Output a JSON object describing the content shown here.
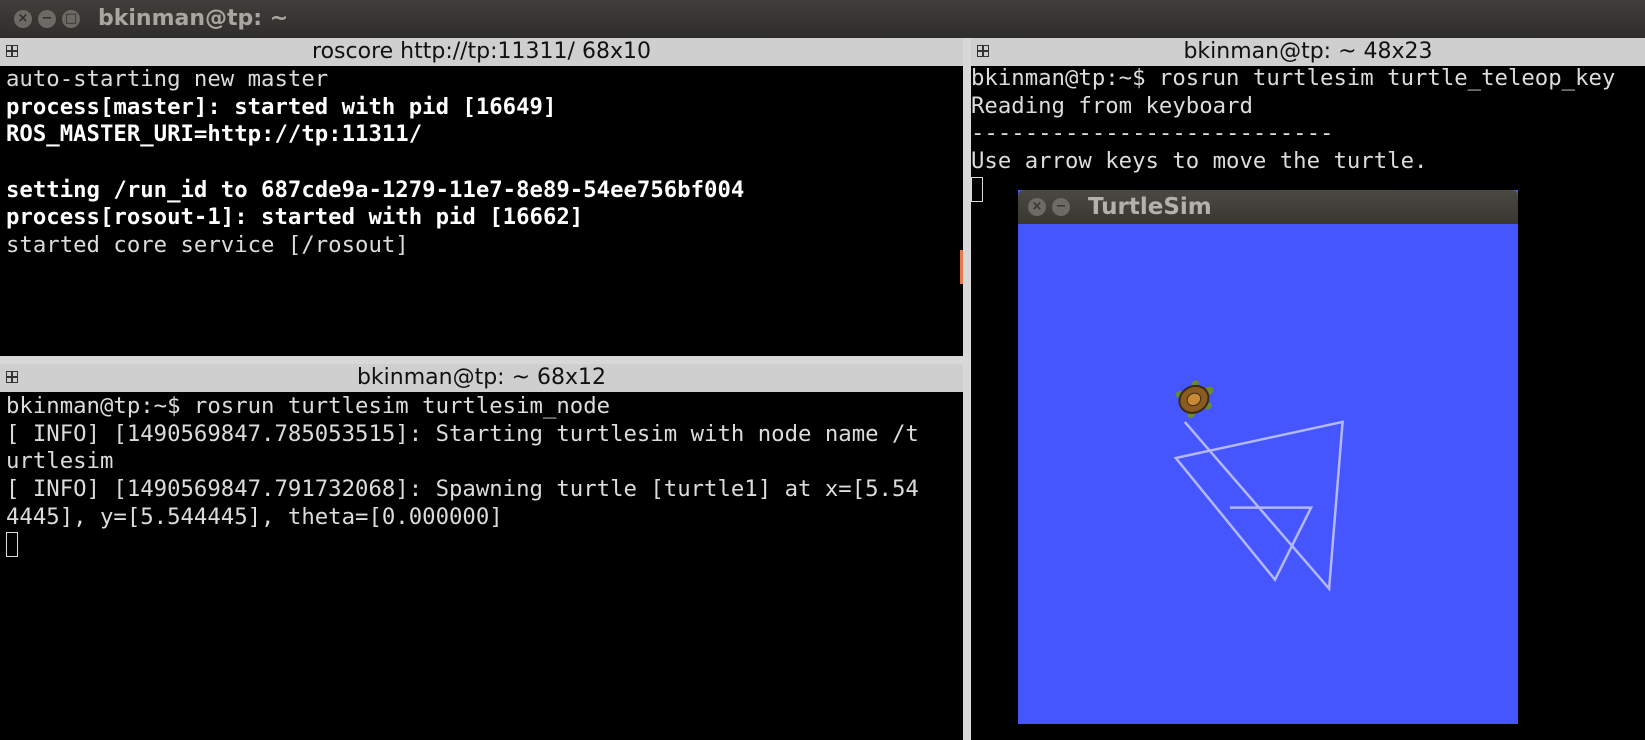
{
  "window": {
    "title": "bkinman@tp: ~",
    "close_glyph": "×",
    "minimize_glyph": "−",
    "maximize_glyph": "□"
  },
  "panes": {
    "roscore": {
      "title": "roscore http://tp:11311/ 68x10",
      "lines": [
        {
          "text": "auto-starting new master",
          "bold": false
        },
        {
          "text": "process[master]: started with pid [16649]",
          "bold": true
        },
        {
          "text": "ROS_MASTER_URI=http://tp:11311/",
          "bold": true
        },
        {
          "text": "",
          "bold": false
        },
        {
          "text": "setting /run_id to 687cde9a-1279-11e7-8e89-54ee756bf004",
          "bold": true
        },
        {
          "text": "process[rosout-1]: started with pid [16662]",
          "bold": true
        },
        {
          "text": "started core service [/rosout]",
          "bold": false
        }
      ]
    },
    "turtlesim_node": {
      "title": "bkinman@tp: ~ 68x12",
      "lines": [
        {
          "text": "bkinman@tp:~$ rosrun turtlesim turtlesim_node",
          "bold": false
        },
        {
          "text": "[ INFO] [1490569847.785053515]: Starting turtlesim with node name /t",
          "bold": false
        },
        {
          "text": "urtlesim",
          "bold": false
        },
        {
          "text": "[ INFO] [1490569847.791732068]: Spawning turtle [turtle1] at x=[5.54",
          "bold": false
        },
        {
          "text": "4445], y=[5.544445], theta=[0.000000]",
          "bold": false
        }
      ]
    },
    "teleop": {
      "title": "bkinman@tp: ~ 48x23",
      "lines": [
        {
          "text": "bkinman@tp:~$ rosrun turtlesim turtle_teleop_key",
          "bold": false
        },
        {
          "text": "Reading from keyboard",
          "bold": false
        },
        {
          "text": "---------------------------",
          "bold": false
        },
        {
          "text": "Use arrow keys to move the turtle.",
          "bold": false
        }
      ]
    }
  },
  "turtlesim": {
    "title": "TurtleSim",
    "background_color": "#4556ff",
    "pen_color": "#b3b8ff",
    "trail_units": [
      [
        3.7,
        6.7
      ],
      [
        6.9,
        3.0
      ],
      [
        7.2,
        6.7
      ],
      [
        3.5,
        5.9
      ],
      [
        5.7,
        3.2
      ],
      [
        6.5,
        4.8
      ],
      [
        4.7,
        4.8
      ]
    ],
    "turtle_units": [
      3.9,
      7.2
    ],
    "turtle_heading_deg": -30
  }
}
